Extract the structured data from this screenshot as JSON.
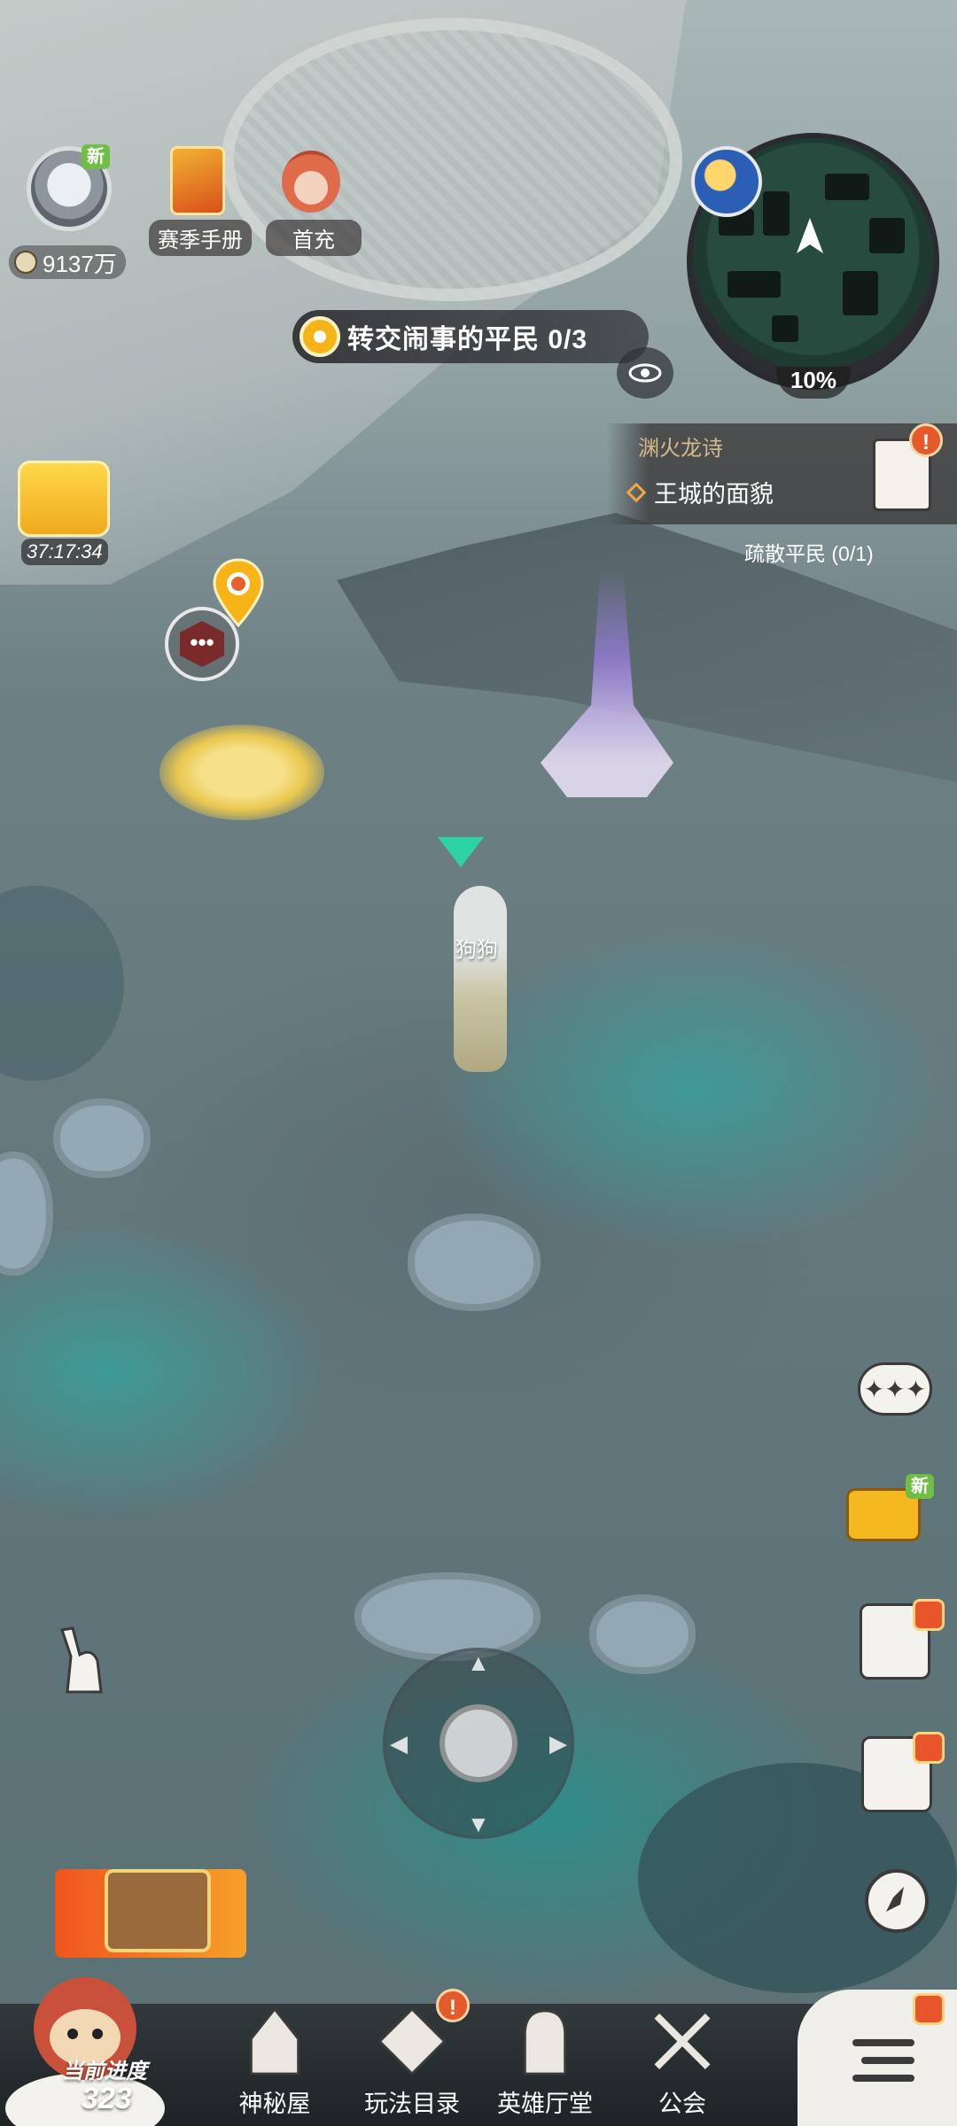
{
  "player": {
    "currency_amount": "9137万",
    "avatar_badge": "新"
  },
  "top_icons": [
    {
      "label": "赛季手册"
    },
    {
      "label": "首充"
    }
  ],
  "quest_tracker": {
    "text": "转交闹事的平民 0/3"
  },
  "minimap": {
    "explore_percent": "10%"
  },
  "task_panel": {
    "chapter": "渊火龙诗",
    "main_task": "王城的面貌",
    "sub_task": "疏散平民 (0/1)",
    "alert": "!"
  },
  "timer": {
    "value": "37:17:34"
  },
  "npc_marker": {
    "label": "•••"
  },
  "player_character": {
    "name": "狗狗"
  },
  "side_buttons": {
    "cart_badge": "新"
  },
  "bottom_nav": [
    {
      "label": "神秘屋"
    },
    {
      "label": "玩法目录",
      "alert": "!"
    },
    {
      "label": "英雄厅堂"
    },
    {
      "label": "公会"
    }
  ],
  "progress": {
    "label": "当前进度",
    "value": "323"
  },
  "colors": {
    "accent_orange": "#f6b417",
    "new_badge_green": "#6fbf46",
    "alert_red": "#e55a2b",
    "player_marker_teal": "#2fd1a6"
  }
}
